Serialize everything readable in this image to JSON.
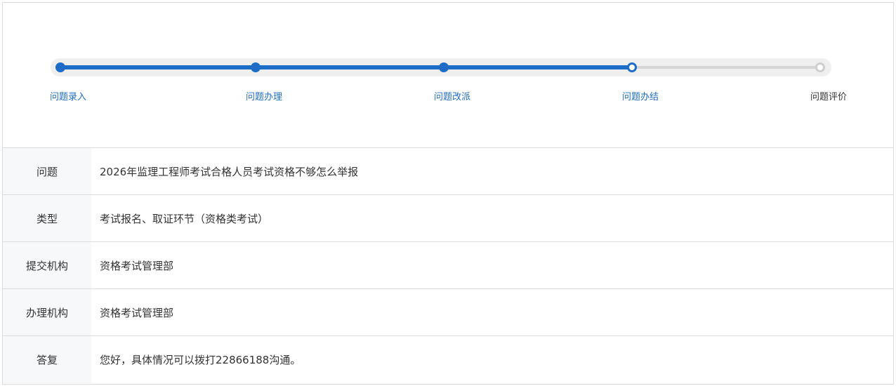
{
  "steps": [
    {
      "label": "问题录入",
      "status": "done"
    },
    {
      "label": "问题办理",
      "status": "done"
    },
    {
      "label": "问题改派",
      "status": "done"
    },
    {
      "label": "问题办结",
      "status": "current"
    },
    {
      "label": "问题评价",
      "status": "pending"
    }
  ],
  "details": {
    "question_label": "问题",
    "question_value": "2026年监理工程师考试合格人员考试资格不够怎么举报",
    "type_label": "类型",
    "type_value": "考试报名、取证环节（资格类考试）",
    "submitter_label": "提交机构",
    "submitter_value": "资格考试管理部",
    "handler_label": "办理机构",
    "handler_value": "资格考试管理部",
    "reply_label": "答复",
    "reply_value": "您好，具体情况可以拨打22866188沟通。"
  },
  "colors": {
    "accent": "#1d6cc7",
    "pending": "#cfcfcf",
    "label_bg": "#f7f8fa"
  }
}
